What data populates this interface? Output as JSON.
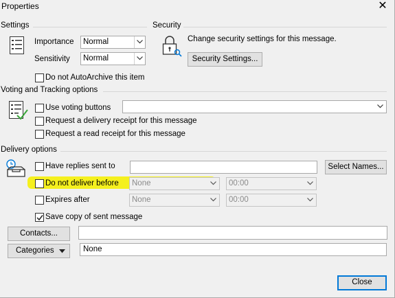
{
  "window": {
    "title": "Properties",
    "close_glyph": "✕"
  },
  "settings": {
    "header": "Settings",
    "importance_label": "Importance",
    "importance_value": "Normal",
    "sensitivity_label": "Sensitivity",
    "sensitivity_value": "Normal",
    "autoarchive_label": "Do not AutoArchive this item",
    "autoarchive_checked": false
  },
  "security": {
    "header": "Security",
    "description": "Change security settings for this message.",
    "button_label": "Security Settings..."
  },
  "voting": {
    "header": "Voting and Tracking options",
    "use_voting_label": "Use voting buttons",
    "voting_value": "",
    "delivery_receipt_label": "Request a delivery receipt for this message",
    "read_receipt_label": "Request a read receipt for this message"
  },
  "delivery": {
    "header": "Delivery options",
    "replies_label": "Have replies sent to",
    "replies_value": "",
    "select_names_label": "Select Names...",
    "deliver_before_label": "Do not deliver before",
    "deliver_before_date": "None",
    "deliver_before_time": "00:00",
    "expires_label": "Expires after",
    "expires_date": "None",
    "expires_time": "00:00",
    "save_copy_label": "Save copy of sent message",
    "save_copy_checked": true
  },
  "contacts": {
    "button_label": "Contacts...",
    "value": ""
  },
  "categories": {
    "button_label": "Categories",
    "value": "None"
  },
  "footer": {
    "close_label": "Close"
  },
  "colors": {
    "highlight": "#f5f01e",
    "accent": "#0078d7"
  }
}
